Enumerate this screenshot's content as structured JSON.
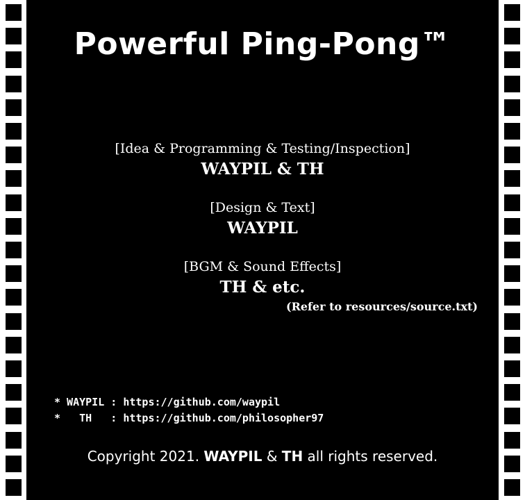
{
  "title": "Powerful Ping-Pong™",
  "credits": [
    {
      "role": "[Idea & Programming & Testing/Inspection]",
      "name": "WAYPIL & TH"
    },
    {
      "role": "[Design & Text]",
      "name": "WAYPIL"
    },
    {
      "role": "[BGM & Sound Effects]",
      "name": "TH & etc.",
      "note": "(Refer to resources/source.txt)"
    }
  ],
  "links": [
    {
      "text": "* WAYPIL : https://github.com/waypil"
    },
    {
      "text": "*   TH   : https://github.com/philosopher97"
    }
  ],
  "copyright": {
    "prefix": "Copyright 2021. ",
    "name1": "WAYPIL",
    "amp": " & ",
    "name2": "TH",
    "suffix": " all rights reserved."
  },
  "colors": {
    "background": "#000000",
    "text": "#ffffff",
    "film_strip": "#ffffff"
  }
}
